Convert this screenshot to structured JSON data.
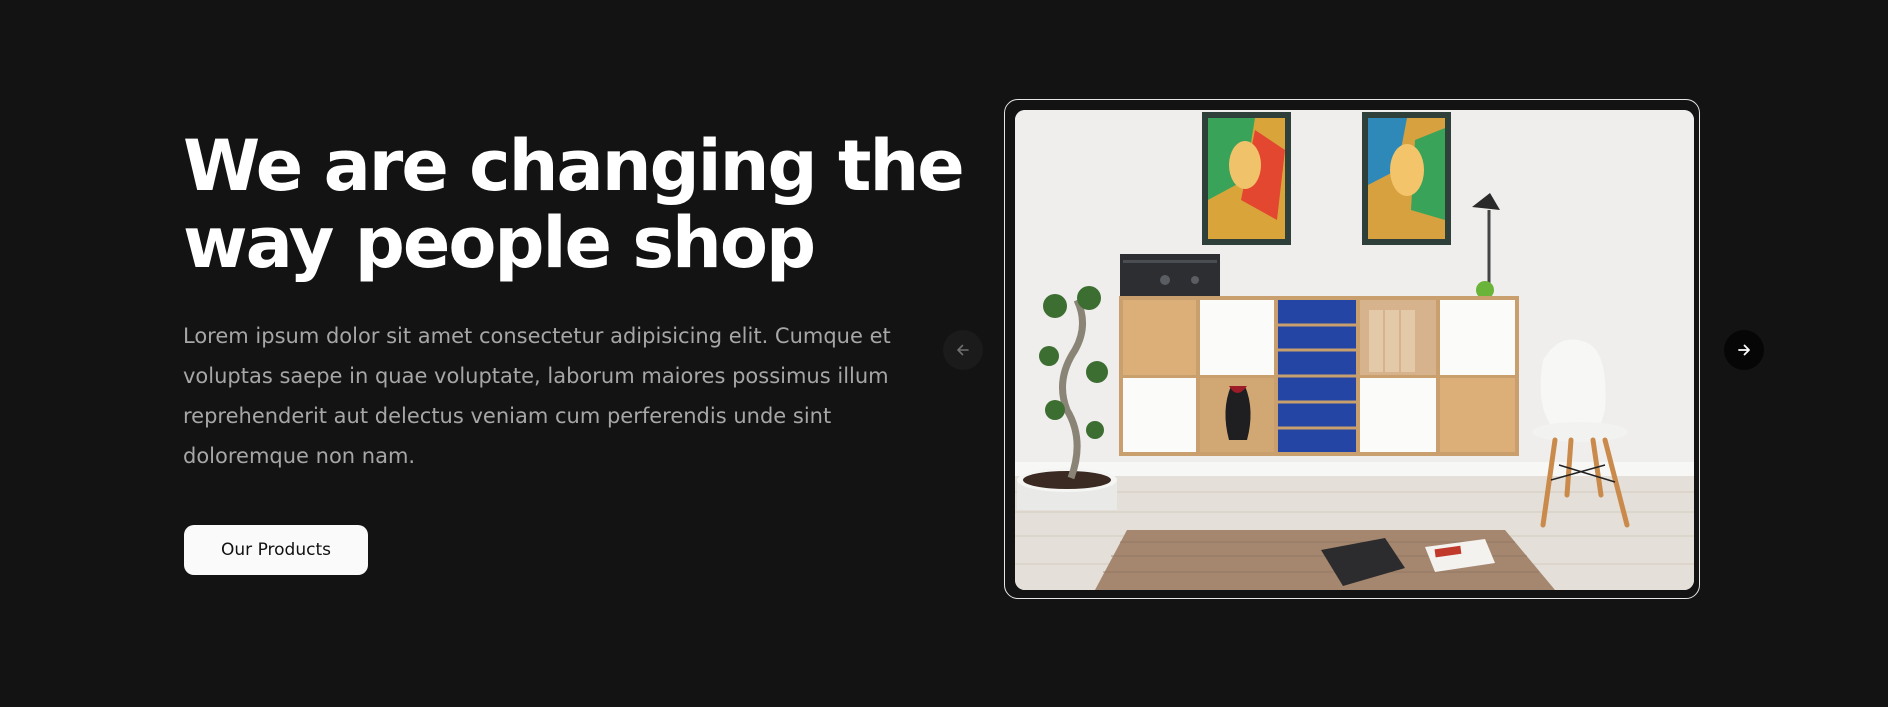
{
  "hero": {
    "headline_line1": "We are changing the",
    "headline_line2": "way people shop",
    "description_lines": [
      "Lorem ipsum dolor sit amet consectetur adipisicing elit. Cumque et",
      "voluptas saepe in quae voluptate, laborum maiores possimus illum",
      "reprehenderit aut delectus veniam cum perferendis unde sint",
      "doloremque non nam."
    ],
    "cta_label": "Our Products"
  },
  "carousel": {
    "prev_icon": "arrow-left-icon",
    "next_icon": "arrow-right-icon"
  },
  "colors": {
    "background": "#131313",
    "headline": "#ffffff",
    "body_text": "#a6a6a6",
    "button_bg": "#fafafa",
    "button_text": "#111111",
    "frame_border": "#e6e6e6"
  }
}
